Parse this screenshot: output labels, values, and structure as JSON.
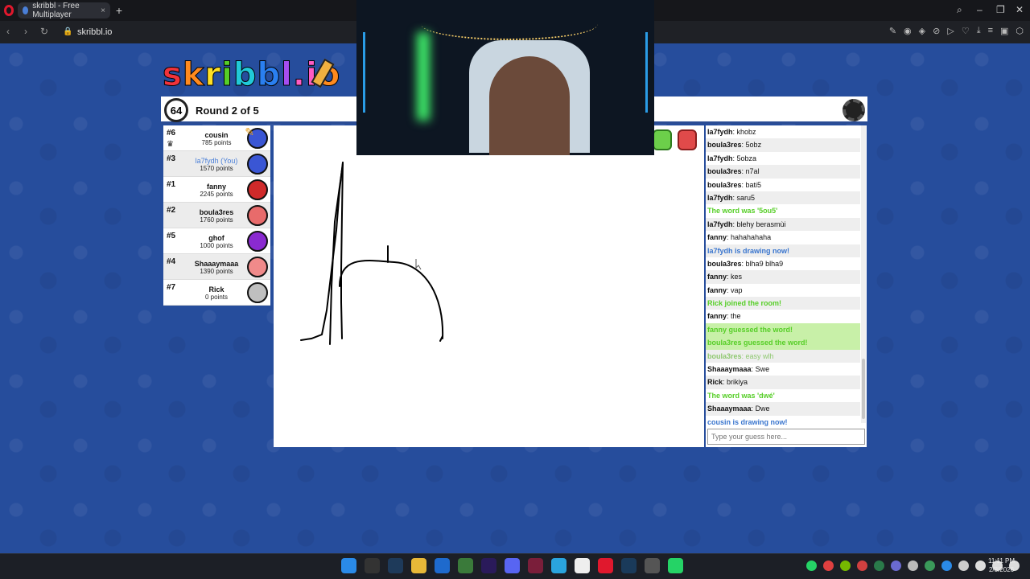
{
  "browser": {
    "tab_title": "skribbl - Free Multiplayer",
    "url": "skribbl.io"
  },
  "game": {
    "logo": "skribbl.io",
    "timer": "64",
    "round_text": "Round 2 of 5"
  },
  "players": [
    {
      "rank": "#6",
      "name": "cousin",
      "points": "785 points",
      "avatar_color": "#3a56d4",
      "is_you": false
    },
    {
      "rank": "#3",
      "name": "la7fydh (You)",
      "points": "1570 points",
      "avatar_color": "#3a56d4",
      "is_you": true
    },
    {
      "rank": "#1",
      "name": "fanny",
      "points": "2245 points",
      "avatar_color": "#d02a2a",
      "is_you": false
    },
    {
      "rank": "#2",
      "name": "boula3res",
      "points": "1760 points",
      "avatar_color": "#e86b6b",
      "is_you": false
    },
    {
      "rank": "#5",
      "name": "ghof",
      "points": "1000 points",
      "avatar_color": "#8a2ad0",
      "is_you": false
    },
    {
      "rank": "#4",
      "name": "Shaaaymaaa",
      "points": "1390 points",
      "avatar_color": "#f08a8a",
      "is_you": false
    },
    {
      "rank": "#7",
      "name": "Rick",
      "points": "0 points",
      "avatar_color": "#bfbfbf",
      "is_you": false
    }
  ],
  "chat": [
    {
      "author": "la7fydh",
      "text": "khobz",
      "type": "normal"
    },
    {
      "author": "boula3res",
      "text": "5obz",
      "type": "normal"
    },
    {
      "author": "la7fydh",
      "text": "5obza",
      "type": "normal"
    },
    {
      "author": "boula3res",
      "text": "n7al",
      "type": "normal"
    },
    {
      "author": "boula3res",
      "text": "bati5",
      "type": "normal"
    },
    {
      "author": "la7fydh",
      "text": "saru5",
      "type": "normal"
    },
    {
      "author": "",
      "text": "The word was '5ou5'",
      "type": "green"
    },
    {
      "author": "la7fydh",
      "text": "blehy berasmùi",
      "type": "normal"
    },
    {
      "author": "fanny",
      "text": "hahahahaha",
      "type": "normal"
    },
    {
      "author": "",
      "text": "la7fydh is drawing now!",
      "type": "blue"
    },
    {
      "author": "boula3res",
      "text": "blha9 blha9",
      "type": "normal"
    },
    {
      "author": "fanny",
      "text": "kes",
      "type": "normal"
    },
    {
      "author": "fanny",
      "text": "vap",
      "type": "normal"
    },
    {
      "author": "",
      "text": "Rick joined the room!",
      "type": "green"
    },
    {
      "author": "fanny",
      "text": "the",
      "type": "normal"
    },
    {
      "author": "",
      "text": "fanny guessed the word!",
      "type": "guess"
    },
    {
      "author": "",
      "text": "boula3res guessed the word!",
      "type": "guess"
    },
    {
      "author": "boula3res",
      "text": "easy wlh",
      "type": "close"
    },
    {
      "author": "Shaaaymaaa",
      "text": "Swe",
      "type": "normal"
    },
    {
      "author": "Rick",
      "text": "brikiya",
      "type": "normal"
    },
    {
      "author": "",
      "text": "The word was 'dwé'",
      "type": "green"
    },
    {
      "author": "Shaaaymaaa",
      "text": "Dwe",
      "type": "normal"
    },
    {
      "author": "",
      "text": "cousin is drawing now!",
      "type": "blue"
    }
  ],
  "guess_input": {
    "placeholder": "Type your guess here..."
  },
  "taskbar": {
    "time": "11:11 PM",
    "date": "2/8/2026"
  },
  "colors": {
    "background_blue": "#264d9c",
    "accent_green": "#56ce27",
    "accent_blue": "#3975ce"
  }
}
